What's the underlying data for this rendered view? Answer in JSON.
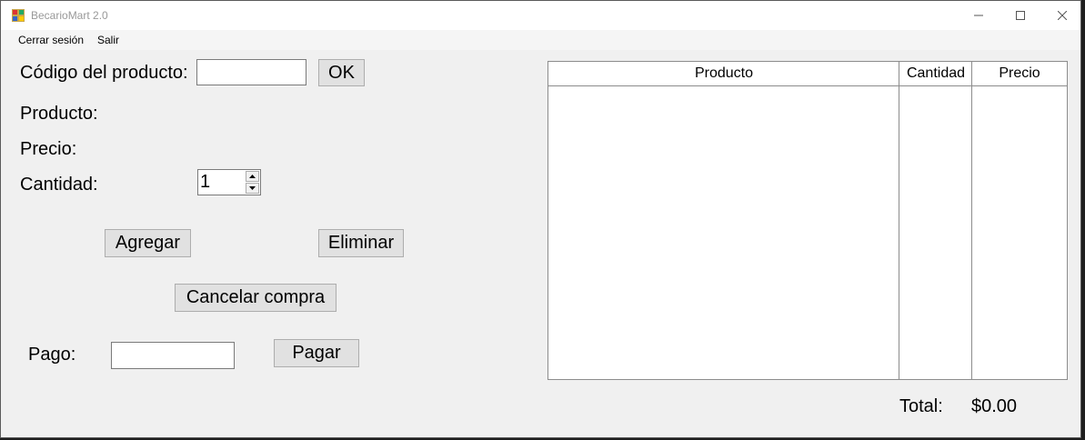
{
  "window": {
    "title": "BecarioMart 2.0"
  },
  "menu": {
    "items": [
      "Cerrar sesión",
      "Salir"
    ]
  },
  "form": {
    "codigo_label": "Código del producto:",
    "codigo_value": "",
    "ok_label": "OK",
    "producto_label": "Producto:",
    "precio_label": "Precio:",
    "cantidad_label": "Cantidad:",
    "cantidad_value": "1",
    "agregar_label": "Agregar",
    "eliminar_label": "Eliminar",
    "cancelar_label": "Cancelar compra",
    "pago_label": "Pago:",
    "pago_value": "",
    "pagar_label": "Pagar"
  },
  "table": {
    "columns": [
      "Producto",
      "Cantidad",
      "Precio"
    ],
    "rows": []
  },
  "total": {
    "label": "Total:",
    "value": "$0.00"
  }
}
